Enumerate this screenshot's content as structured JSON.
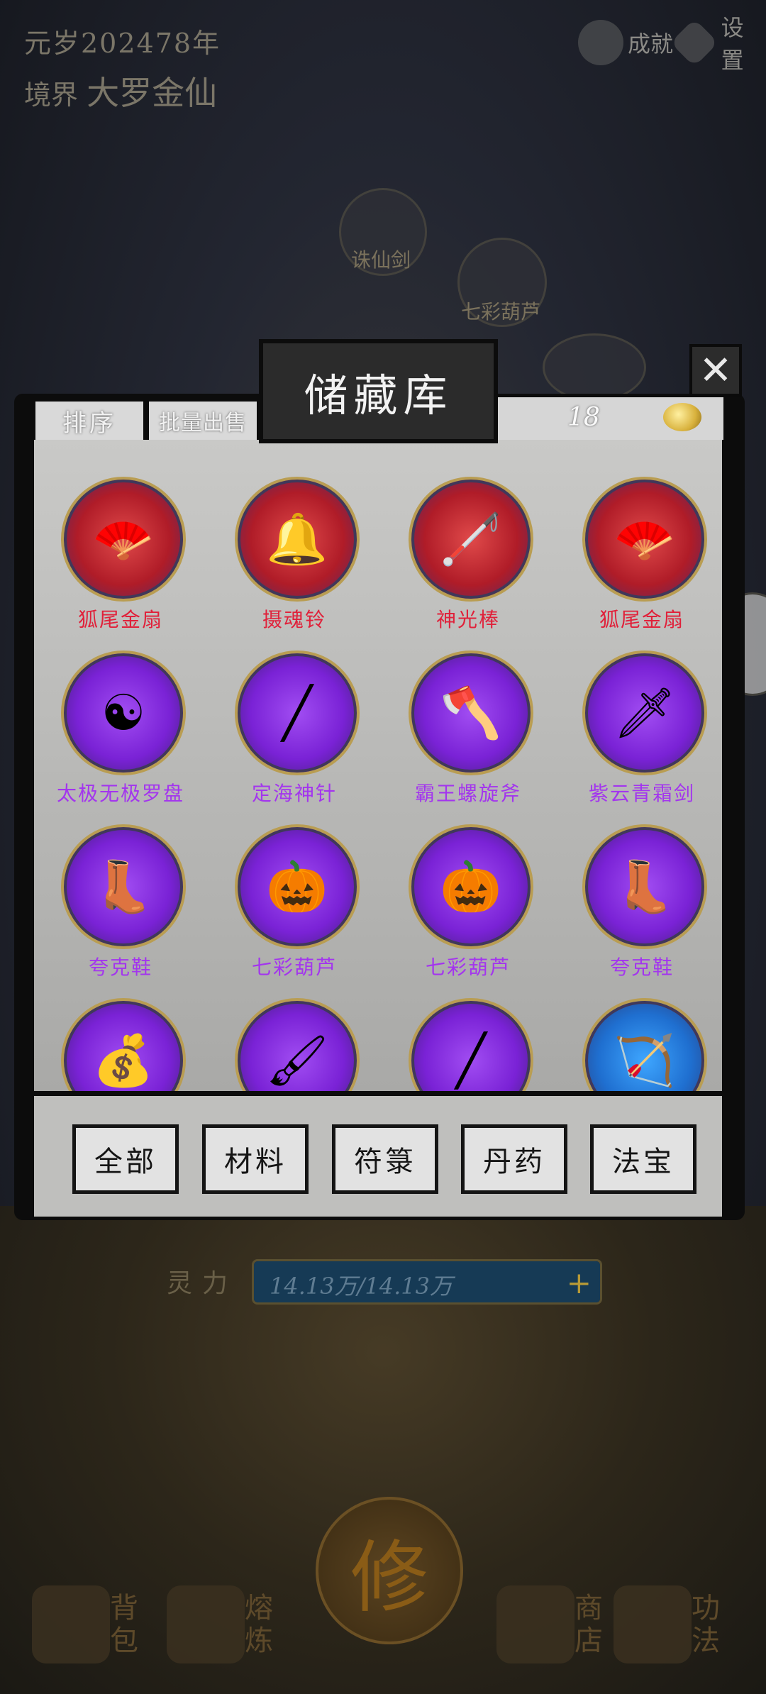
{
  "hud": {
    "era": "元岁202478年",
    "realm_prefix": "境界",
    "realm_name": "大罗金仙",
    "achievements_label": "成就",
    "settings_label": "设置"
  },
  "map_nodes": [
    "诛仙剑",
    "七彩葫芦"
  ],
  "storage": {
    "title": "储藏库",
    "close_symbol": "✕",
    "sort_label": "排序",
    "batch_sell_label": "批量出售",
    "count": "18"
  },
  "items": [
    {
      "name": "狐尾金扇",
      "rarity": "red",
      "icon": "fan-icon",
      "glyph": "🪭"
    },
    {
      "name": "摄魂铃",
      "rarity": "red",
      "icon": "bell-icon",
      "glyph": "🔔"
    },
    {
      "name": "神光棒",
      "rarity": "red",
      "icon": "staff-icon",
      "glyph": "🦯"
    },
    {
      "name": "狐尾金扇",
      "rarity": "red",
      "icon": "fan-icon",
      "glyph": "🪭"
    },
    {
      "name": "太极无极罗盘",
      "rarity": "purple",
      "icon": "taiji-compass-icon",
      "glyph": "☯"
    },
    {
      "name": "定海神针",
      "rarity": "purple",
      "icon": "staff-icon",
      "glyph": "╱"
    },
    {
      "name": "霸王螺旋斧",
      "rarity": "purple",
      "icon": "axe-icon",
      "glyph": "🪓"
    },
    {
      "name": "紫云青霜剑",
      "rarity": "purple",
      "icon": "sword-icon",
      "glyph": "🗡"
    },
    {
      "name": "夸克鞋",
      "rarity": "purple",
      "icon": "boot-icon",
      "glyph": "👢"
    },
    {
      "name": "七彩葫芦",
      "rarity": "purple",
      "icon": "gourd-icon",
      "glyph": "🎃"
    },
    {
      "name": "七彩葫芦",
      "rarity": "purple",
      "icon": "gourd-icon",
      "glyph": "🎃"
    },
    {
      "name": "夸克鞋",
      "rarity": "purple",
      "icon": "boot-icon",
      "glyph": "👢"
    },
    {
      "name": "",
      "rarity": "purple",
      "icon": "pouch-icon",
      "glyph": "💰"
    },
    {
      "name": "",
      "rarity": "purple",
      "icon": "brush-icon",
      "glyph": "🖌"
    },
    {
      "name": "",
      "rarity": "purple",
      "icon": "staff-icon",
      "glyph": "╱"
    },
    {
      "name": "",
      "rarity": "blue",
      "icon": "bow-icon",
      "glyph": "🏹"
    }
  ],
  "categories": [
    "全部",
    "材料",
    "符箓",
    "丹药",
    "法宝"
  ],
  "spirit": {
    "label": "灵力",
    "value_text": "14.13万/14.13万",
    "fraction": 1.0,
    "plus_symbol": "+"
  },
  "cultivate_label": "修",
  "bottom_nav": [
    "背包",
    "熔炼",
    "商店",
    "功法"
  ]
}
